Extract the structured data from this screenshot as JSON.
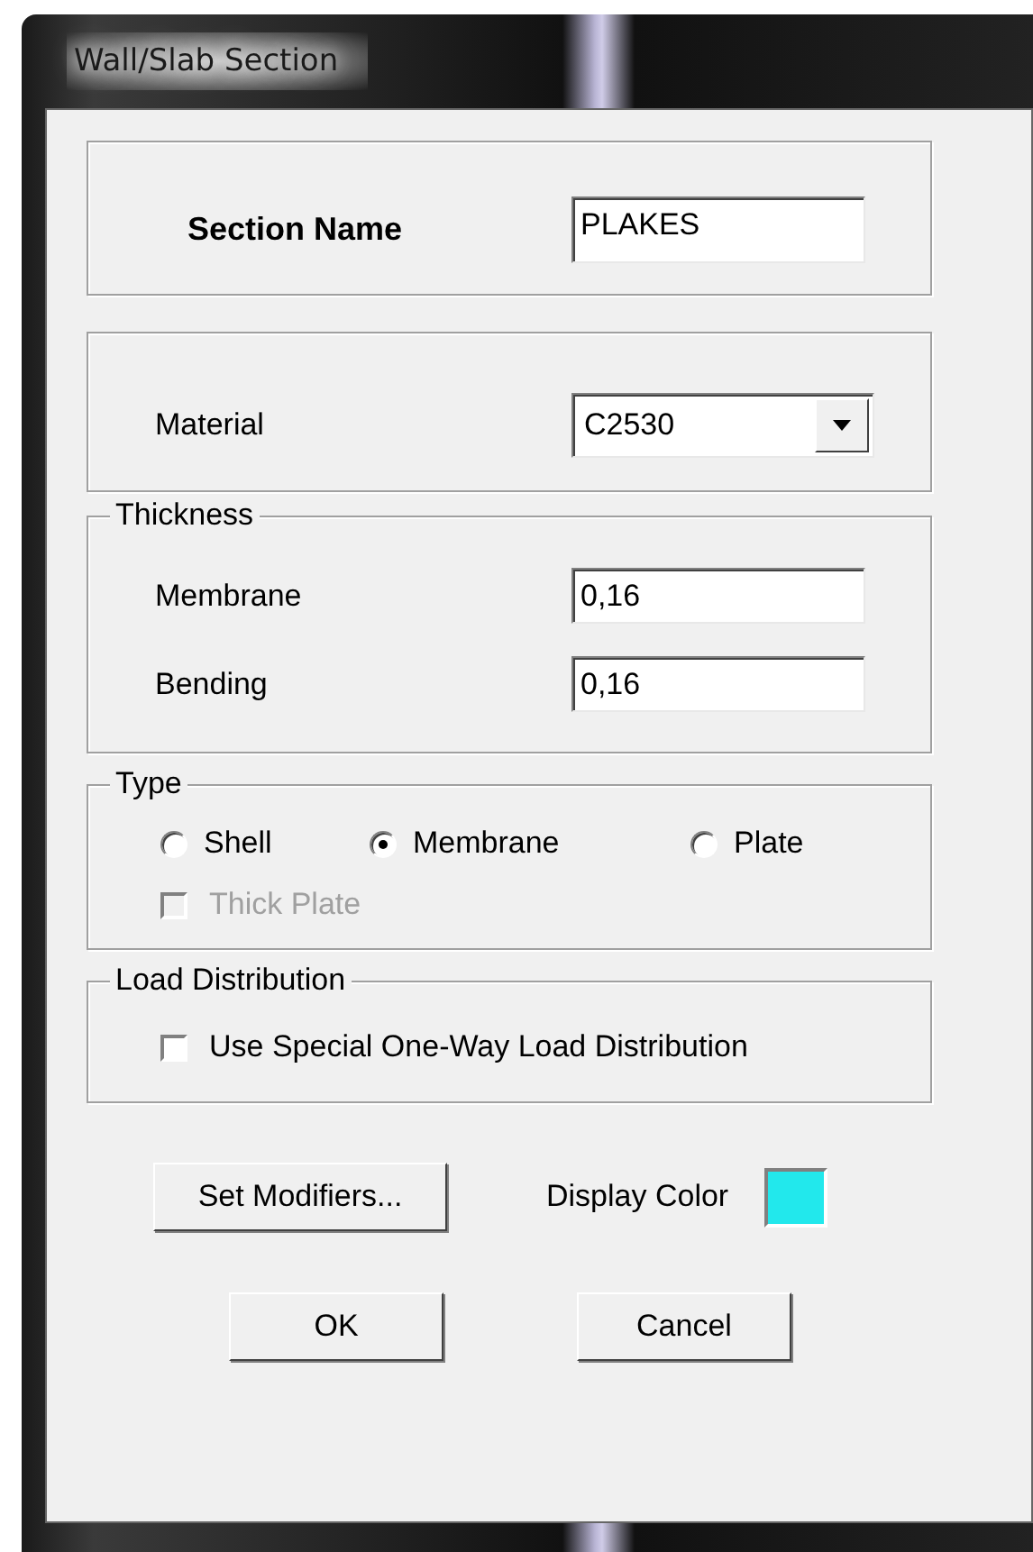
{
  "window": {
    "title": "Wall/Slab Section"
  },
  "section_name": {
    "label": "Section Name",
    "value": "PLAKES"
  },
  "material": {
    "label": "Material",
    "value": "C2530"
  },
  "thickness": {
    "title": "Thickness",
    "fields": [
      {
        "label": "Membrane",
        "value": "0,16"
      },
      {
        "label": "Bending",
        "value": "0,16"
      }
    ]
  },
  "type": {
    "title": "Type",
    "options": [
      {
        "label": "Shell",
        "selected": false
      },
      {
        "label": "Membrane",
        "selected": true
      },
      {
        "label": "Plate",
        "selected": false
      }
    ],
    "thick_plate": {
      "label": "Thick Plate",
      "checked": false,
      "disabled": true
    }
  },
  "load_distribution": {
    "title": "Load Distribution",
    "option": {
      "label": "Use Special One-Way Load Distribution",
      "checked": false
    }
  },
  "set_modifiers_button": "Set Modifiers...",
  "display_color": {
    "label": "Display Color",
    "color": "#22e8ec"
  },
  "buttons": [
    "OK",
    "Cancel"
  ]
}
